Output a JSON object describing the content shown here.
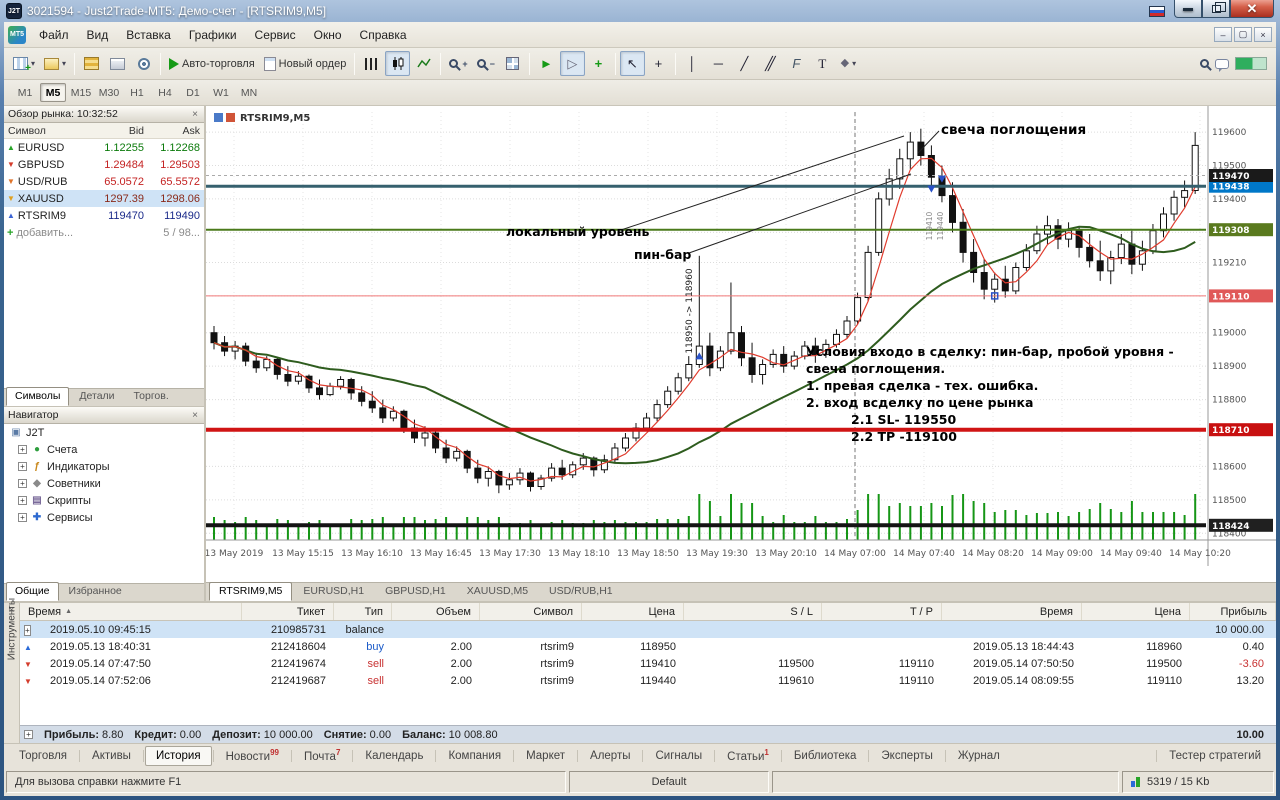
{
  "window": {
    "title": "3021594 - Just2Trade-MT5: Демо-счет - [RTSRIM9,M5]",
    "logo": "J2T",
    "mt5_logo": "MT5"
  },
  "menu": {
    "items": [
      "Файл",
      "Вид",
      "Вставка",
      "Графики",
      "Сервис",
      "Окно",
      "Справка"
    ]
  },
  "toolbar": {
    "autotrade_label": "Авто-торговля",
    "new_order_label": "Новый ордер"
  },
  "timeframes": {
    "items": [
      "M1",
      "M5",
      "M15",
      "M30",
      "H1",
      "H4",
      "D1",
      "W1",
      "MN"
    ],
    "active": "M5"
  },
  "market_watch": {
    "title": "Обзор рынка: 10:32:52",
    "columns": [
      "Символ",
      "Bid",
      "Ask"
    ],
    "rows": [
      {
        "symbol": "EURUSD",
        "bid": "1.12255",
        "ask": "1.12268",
        "price_color": "#0b7a0b",
        "icon": "up",
        "icon_color": "#28a428",
        "selected": false
      },
      {
        "symbol": "GBPUSD",
        "bid": "1.29484",
        "ask": "1.29503",
        "price_color": "#c42222",
        "icon": "down",
        "icon_color": "#d43c2c",
        "selected": false
      },
      {
        "symbol": "USD/RUB",
        "bid": "65.0572",
        "ask": "65.5572",
        "price_color": "#c42222",
        "icon": "down",
        "icon_color": "#e0742a",
        "selected": false
      },
      {
        "symbol": "XAUUSD",
        "bid": "1297.39",
        "ask": "1298.06",
        "price_color": "#8a2a1a",
        "icon": "down",
        "icon_color": "#e0a020",
        "selected": true
      },
      {
        "symbol": "RTSRIM9",
        "bid": "119470",
        "ask": "119490",
        "price_color": "#1a2a8a",
        "icon": "up",
        "icon_color": "#3c64d4",
        "selected": false
      }
    ],
    "add_label": "добавить...",
    "count_label": "5 / 98...",
    "tabs": [
      {
        "label": "Символы",
        "active": true
      },
      {
        "label": "Детали",
        "active": false
      },
      {
        "label": "Торгов.",
        "active": false
      }
    ]
  },
  "navigator": {
    "title": "Навигатор",
    "root": "J2T",
    "items": [
      {
        "label": "Счета",
        "icon": "accounts-icon",
        "color": "#2e9e3e",
        "glyph": "●"
      },
      {
        "label": "Индикаторы",
        "icon": "indicators-icon",
        "color": "#c8871a",
        "glyph": "ƒ"
      },
      {
        "label": "Советники",
        "icon": "experts-icon",
        "color": "#8a8a8a",
        "glyph": "◆"
      },
      {
        "label": "Скрипты",
        "icon": "scripts-icon",
        "color": "#7a6a9a",
        "glyph": "▤"
      },
      {
        "label": "Сервисы",
        "icon": "services-icon",
        "color": "#2e6ad0",
        "glyph": "✚"
      }
    ],
    "tabs": [
      {
        "label": "Общие",
        "active": true
      },
      {
        "label": "Избранное",
        "active": false
      }
    ]
  },
  "chart_data": {
    "type": "candlestick",
    "symbol_label": "RTSRIM9,M5",
    "ylim": [
      118380,
      119660
    ],
    "yticks": [
      119600,
      119500,
      119400,
      119300,
      119210,
      119110,
      119000,
      118900,
      118800,
      118710,
      118600,
      118500,
      118400
    ],
    "xlabels": [
      "13 May 2019",
      "13 May 15:15",
      "13 May 16:10",
      "13 May 16:45",
      "13 May 17:30",
      "13 May 18:10",
      "13 May 18:50",
      "13 May 19:30",
      "13 May 20:10",
      "14 May 07:00",
      "14 May 07:40",
      "14 May 08:20",
      "14 May 09:00",
      "14 May 09:40",
      "14 May 10:20"
    ],
    "day_separator_index": 9,
    "levels": [
      {
        "price": 119438,
        "color": "#35606e",
        "width": 3,
        "dashed": false,
        "badge_bg": "#0077c8"
      },
      {
        "price": 119470,
        "color": "#aaaaaa",
        "width": 1,
        "dashed": true,
        "badge_bg": "#1a1a1a"
      },
      {
        "price": 119308,
        "color": "#4a7a1a",
        "width": 2,
        "dashed": false,
        "badge_bg": "#5a7a1e"
      },
      {
        "price": 119110,
        "color": "#f07878",
        "width": 1,
        "dashed": false,
        "badge_bg": "#e05858"
      },
      {
        "price": 118710,
        "color": "#d01414",
        "width": 4,
        "dashed": false,
        "badge_bg": "#c81010"
      },
      {
        "price": 118424,
        "color": "#141414",
        "width": 4,
        "dashed": false,
        "badge_bg": "#202020"
      }
    ],
    "ma_fast_period": 4,
    "ma_fast_color": "#e03c2e",
    "ma_slow_period": 21,
    "ma_slow_color": "#2e5c1e",
    "volume_color": "#169616",
    "candles": [
      [
        119000,
        119020,
        118950,
        118970
      ],
      [
        118970,
        118990,
        118930,
        118945
      ],
      [
        118945,
        118975,
        118920,
        118960
      ],
      [
        118960,
        118970,
        118900,
        118915
      ],
      [
        118915,
        118940,
        118880,
        118895
      ],
      [
        118895,
        118930,
        118885,
        118920
      ],
      [
        118920,
        118925,
        118860,
        118875
      ],
      [
        118875,
        118900,
        118840,
        118855
      ],
      [
        118855,
        118885,
        118845,
        118870
      ],
      [
        118870,
        118875,
        118820,
        118835
      ],
      [
        118835,
        118860,
        118800,
        118815
      ],
      [
        118815,
        118850,
        118810,
        118840
      ],
      [
        118840,
        118870,
        118830,
        118860
      ],
      [
        118860,
        118865,
        118800,
        118820
      ],
      [
        118820,
        118840,
        118780,
        118795
      ],
      [
        118795,
        118825,
        118760,
        118775
      ],
      [
        118775,
        118800,
        118730,
        118745
      ],
      [
        118745,
        118780,
        118735,
        118765
      ],
      [
        118765,
        118770,
        118700,
        118715
      ],
      [
        118715,
        118740,
        118670,
        118685
      ],
      [
        118685,
        118720,
        118660,
        118700
      ],
      [
        118700,
        118705,
        118640,
        118655
      ],
      [
        118655,
        118680,
        118610,
        118625
      ],
      [
        118625,
        118660,
        118615,
        118645
      ],
      [
        118645,
        118650,
        118580,
        118595
      ],
      [
        118595,
        118620,
        118550,
        118565
      ],
      [
        118565,
        118600,
        118540,
        118585
      ],
      [
        118585,
        118590,
        118520,
        118545
      ],
      [
        118545,
        118580,
        118530,
        118560
      ],
      [
        118560,
        118595,
        118545,
        118580
      ],
      [
        118580,
        118585,
        118525,
        118540
      ],
      [
        118540,
        118575,
        118530,
        118565
      ],
      [
        118565,
        118610,
        118555,
        118595
      ],
      [
        118595,
        118620,
        118560,
        118575
      ],
      [
        118575,
        118615,
        118565,
        118605
      ],
      [
        118605,
        118640,
        118590,
        118625
      ],
      [
        118625,
        118630,
        118570,
        118590
      ],
      [
        118590,
        118635,
        118580,
        118620
      ],
      [
        118620,
        118670,
        118610,
        118655
      ],
      [
        118655,
        118700,
        118645,
        118685
      ],
      [
        118685,
        118730,
        118675,
        118715
      ],
      [
        118715,
        118760,
        118705,
        118745
      ],
      [
        118745,
        118800,
        118735,
        118785
      ],
      [
        118785,
        118840,
        118775,
        118825
      ],
      [
        118825,
        118880,
        118815,
        118865
      ],
      [
        118865,
        118930,
        118855,
        118905
      ],
      [
        118905,
        119230,
        118895,
        118960
      ],
      [
        118960,
        119000,
        118870,
        118895
      ],
      [
        118895,
        118960,
        118885,
        118945
      ],
      [
        118945,
        119150,
        118935,
        119000
      ],
      [
        119000,
        119020,
        118900,
        118925
      ],
      [
        118925,
        118970,
        118850,
        118875
      ],
      [
        118875,
        118920,
        118845,
        118905
      ],
      [
        118905,
        118950,
        118895,
        118935
      ],
      [
        118935,
        118960,
        118880,
        118900
      ],
      [
        118900,
        118945,
        118890,
        118930
      ],
      [
        118930,
        118975,
        118920,
        118960
      ],
      [
        118960,
        118985,
        118910,
        118935
      ],
      [
        118935,
        118980,
        118925,
        118965
      ],
      [
        118965,
        119010,
        118955,
        118995
      ],
      [
        118995,
        119050,
        118985,
        119035
      ],
      [
        119035,
        119120,
        119025,
        119105
      ],
      [
        119105,
        119260,
        119095,
        119240
      ],
      [
        119240,
        119420,
        119230,
        119400
      ],
      [
        119400,
        119490,
        119380,
        119460
      ],
      [
        119460,
        119550,
        119430,
        119520
      ],
      [
        119520,
        119600,
        119490,
        119570
      ],
      [
        119570,
        119610,
        119500,
        119530
      ],
      [
        119530,
        119560,
        119440,
        119465
      ],
      [
        119465,
        119500,
        119390,
        119410
      ],
      [
        119410,
        119450,
        119300,
        119330
      ],
      [
        119330,
        119370,
        119210,
        119240
      ],
      [
        119240,
        119280,
        119150,
        119180
      ],
      [
        119180,
        119220,
        119100,
        119130
      ],
      [
        119130,
        119180,
        119090,
        119160
      ],
      [
        119160,
        119200,
        119105,
        119125
      ],
      [
        119125,
        119210,
        119115,
        119195
      ],
      [
        119195,
        119265,
        119185,
        119245
      ],
      [
        119245,
        119320,
        119235,
        119295
      ],
      [
        119295,
        119350,
        119265,
        119320
      ],
      [
        119320,
        119340,
        119250,
        119280
      ],
      [
        119280,
        119330,
        119255,
        119305
      ],
      [
        119305,
        119315,
        119225,
        119255
      ],
      [
        119255,
        119295,
        119195,
        119215
      ],
      [
        119215,
        119275,
        119155,
        119185
      ],
      [
        119185,
        119245,
        119145,
        119225
      ],
      [
        119225,
        119295,
        119205,
        119265
      ],
      [
        119265,
        119305,
        119175,
        119205
      ],
      [
        119205,
        119275,
        119185,
        119245
      ],
      [
        119245,
        119325,
        119235,
        119305
      ],
      [
        119305,
        119375,
        119285,
        119355
      ],
      [
        119355,
        119425,
        119335,
        119405
      ],
      [
        119405,
        119455,
        119375,
        119425
      ],
      [
        119425,
        119600,
        119415,
        119560
      ]
    ],
    "annotations": {
      "engulfing_label": "свеча поглощения",
      "local_level_label": "локальный уровень",
      "pinbar_label": "пин-бар",
      "trade_note_vertical": "118950 -> 118960",
      "trade_labels_vertical": [
        "119410",
        "119440"
      ],
      "note_lines": [
        "Условия входо в сделку: пин-бар, пробой уровня -",
        "свеча поглощения.",
        "1. превая сделка - тех. ошибка.",
        "2. вход всделку по цене рынка",
        "2.1 SL- 119550",
        "2.2  TP -119100"
      ]
    }
  },
  "chart_tabs": [
    {
      "label": "RTSRIM9,M5",
      "active": true
    },
    {
      "label": "EURUSD,H1",
      "active": false
    },
    {
      "label": "GBPUSD,H1",
      "active": false
    },
    {
      "label": "XAUUSD,M5",
      "active": false
    },
    {
      "label": "USD/RUB,H1",
      "active": false
    }
  ],
  "toolbox": {
    "vertical_label": "Инструменты",
    "columns": [
      "Время",
      "Тикет",
      "Тип",
      "Объем",
      "Символ",
      "Цена",
      "S / L",
      "T / P",
      "Время",
      "Цена",
      "Прибыль"
    ],
    "rows": [
      {
        "icon": "expand",
        "time": "2019.05.10 09:45:15",
        "ticket": "210985731",
        "type": "balance",
        "type_color": "#222222",
        "volume": "",
        "symbol": "",
        "price": "",
        "sl": "",
        "tp": "",
        "time2": "",
        "price2": "",
        "profit": "10 000.00",
        "profit_color": "#222222",
        "selected": true
      },
      {
        "icon": "buy",
        "time": "2019.05.13 18:40:31",
        "ticket": "212418604",
        "type": "buy",
        "type_color": "#1a5ac8",
        "volume": "2.00",
        "symbol": "rtsrim9",
        "price": "118950",
        "sl": "",
        "tp": "",
        "time2": "2019.05.13 18:44:43",
        "price2": "118960",
        "profit": "0.40",
        "profit_color": "#222222",
        "selected": false
      },
      {
        "icon": "sell",
        "time": "2019.05.14 07:47:50",
        "ticket": "212419674",
        "type": "sell",
        "type_color": "#c83232",
        "volume": "2.00",
        "symbol": "rtsrim9",
        "price": "119410",
        "sl": "119500",
        "tp": "119110",
        "time2": "2019.05.14 07:50:50",
        "price2": "119500",
        "profit": "-3.60",
        "profit_color": "#c83232",
        "selected": false
      },
      {
        "icon": "sell",
        "time": "2019.05.14 07:52:06",
        "ticket": "212419687",
        "type": "sell",
        "type_color": "#c83232",
        "volume": "2.00",
        "symbol": "rtsrim9",
        "price": "119440",
        "sl": "119610",
        "tp": "119110",
        "time2": "2019.05.14 08:09:55",
        "price2": "119110",
        "profit": "13.20",
        "profit_color": "#222222",
        "selected": false
      }
    ],
    "summary": {
      "segments": [
        {
          "label": "Прибыль:",
          "value": "8.80"
        },
        {
          "label": "Кредит:",
          "value": "0.00"
        },
        {
          "label": "Депозит:",
          "value": "10 000.00"
        },
        {
          "label": "Снятие:",
          "value": "0.00"
        },
        {
          "label": "Баланс:",
          "value": "10 008.80"
        }
      ],
      "right": "10.00"
    },
    "tabs": [
      {
        "label": "Торговля",
        "badge": "",
        "active": false
      },
      {
        "label": "Активы",
        "badge": "",
        "active": false
      },
      {
        "label": "История",
        "badge": "",
        "active": true
      },
      {
        "label": "Новости",
        "badge": "99",
        "active": false
      },
      {
        "label": "Почта",
        "badge": "7",
        "active": false
      },
      {
        "label": "Календарь",
        "badge": "",
        "active": false
      },
      {
        "label": "Компания",
        "badge": "",
        "active": false
      },
      {
        "label": "Маркет",
        "badge": "",
        "active": false
      },
      {
        "label": "Алерты",
        "badge": "",
        "active": false
      },
      {
        "label": "Сигналы",
        "badge": "",
        "active": false
      },
      {
        "label": "Статьи",
        "badge": "1",
        "active": false
      },
      {
        "label": "Библиотека",
        "badge": "",
        "active": false
      },
      {
        "label": "Эксперты",
        "badge": "",
        "active": false
      },
      {
        "label": "Журнал",
        "badge": "",
        "active": false
      }
    ],
    "right_tab": "Тестер стратегий"
  },
  "statusbar": {
    "help": "Для вызова справки нажмите F1",
    "profile": "Default",
    "traffic": "5319 / 15 Kb"
  }
}
